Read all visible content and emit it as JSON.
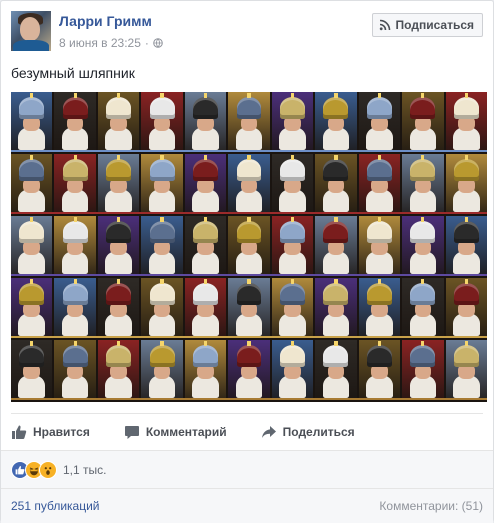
{
  "post": {
    "author": "Ларри Гримм",
    "timestamp": "8 июня в 23:25",
    "separator": "·",
    "privacy_icon": "globe-icon",
    "subscribe_label": "Подписаться",
    "subscribe_icon": "rss-icon",
    "text": "безумный шляпник",
    "photo": {
      "description_icon": "photo-collage",
      "rows": 5,
      "columns": 11,
      "row_border_colors": [
        "#6d8fc7",
        "#9c2b2b",
        "#5e4aa0",
        "#c9a24a",
        "#a87b33"
      ],
      "hat_palette": [
        "#8ea6c8",
        "#e8e8e8",
        "#c9b36a",
        "#7a1d1d",
        "#2a2a2a",
        "#b9992f",
        "#efe6cf",
        "#5b6f8f"
      ],
      "tile_bg_palette": [
        "#3a5d8f",
        "#8a2323",
        "#4b2f7a",
        "#6b5424",
        "#b08a3c",
        "#2e2a26",
        "#6a7c95"
      ]
    }
  },
  "actions": {
    "like_label": "Нравится",
    "like_icon": "thumbs-up-icon",
    "comment_label": "Комментарий",
    "comment_icon": "speech-bubble-icon",
    "share_label": "Поделиться",
    "share_icon": "share-arrow-icon"
  },
  "reactions": {
    "icons": [
      "like-reaction-icon",
      "haha-reaction-icon",
      "wow-reaction-icon"
    ],
    "colors": {
      "like": "#4267b2",
      "haha": "#f7b125",
      "wow": "#f7b125"
    },
    "count": "1,1 тыс."
  },
  "footer": {
    "shares_label": "251 публикаций",
    "comments_label": "Комментарии: (51)"
  },
  "colors": {
    "link": "#365899",
    "muted": "#90949c",
    "action_text": "#4b4f56"
  }
}
